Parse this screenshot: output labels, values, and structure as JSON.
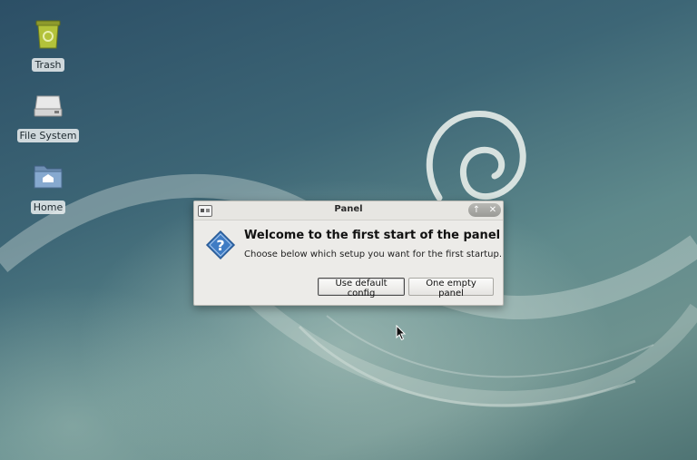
{
  "desktop": {
    "icons": [
      {
        "label": "Trash",
        "icon": "trash-icon"
      },
      {
        "label": "File System",
        "icon": "drive-icon"
      },
      {
        "label": "Home",
        "icon": "home-folder-icon"
      }
    ]
  },
  "dialog": {
    "title": "Panel",
    "heading": "Welcome to the first start of the panel",
    "message": "Choose below which setup you want for the first startup.",
    "buttons": {
      "default_label": "Use default config",
      "empty_label": "One empty panel"
    },
    "window_controls": {
      "shade_icon": "↑",
      "close_icon": "✕"
    },
    "icon": "question-icon"
  },
  "colors": {
    "desktop_top": "#2c4f66",
    "desktop_bottom": "#6d928f",
    "dialog_bg": "#ecebe8",
    "accent": "#3f7cc4"
  }
}
